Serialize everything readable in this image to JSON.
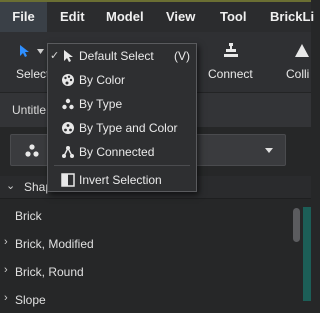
{
  "menubar": {
    "items": [
      {
        "label": "File"
      },
      {
        "label": "Edit"
      },
      {
        "label": "Model"
      },
      {
        "label": "View"
      },
      {
        "label": "Tool"
      },
      {
        "label": "BrickLi"
      }
    ]
  },
  "toolbar": {
    "select_label": "Select",
    "connect_label": "Connect",
    "collision_label": "Colli"
  },
  "document": {
    "title": "Untitle"
  },
  "shapes_panel": {
    "header": "Shap",
    "items": [
      {
        "label": "Brick",
        "expandable": false
      },
      {
        "label": "Brick, Modified",
        "expandable": true
      },
      {
        "label": "Brick, Round",
        "expandable": true
      },
      {
        "label": "Slope",
        "expandable": true
      }
    ]
  },
  "select_dropdown": {
    "items": [
      {
        "label": "Default Select",
        "shortcut": "(V)",
        "icon": "cursor-icon",
        "checked": true
      },
      {
        "label": "By Color",
        "shortcut": "",
        "icon": "palette-icon",
        "checked": false
      },
      {
        "label": "By Type",
        "shortcut": "",
        "icon": "dots-triangle-icon",
        "checked": false
      },
      {
        "label": "By Type and Color",
        "shortcut": "",
        "icon": "palette-dots-icon",
        "checked": false
      },
      {
        "label": "By Connected",
        "shortcut": "",
        "icon": "connected-nodes-icon",
        "checked": false
      },
      {
        "label": "Invert Selection",
        "shortcut": "",
        "icon": "invert-icon",
        "checked": false
      }
    ]
  },
  "colors": {
    "accent": "#1e90ff",
    "menubar_top_border": "#6b6f33",
    "teal_strip": "#1c5e57"
  }
}
